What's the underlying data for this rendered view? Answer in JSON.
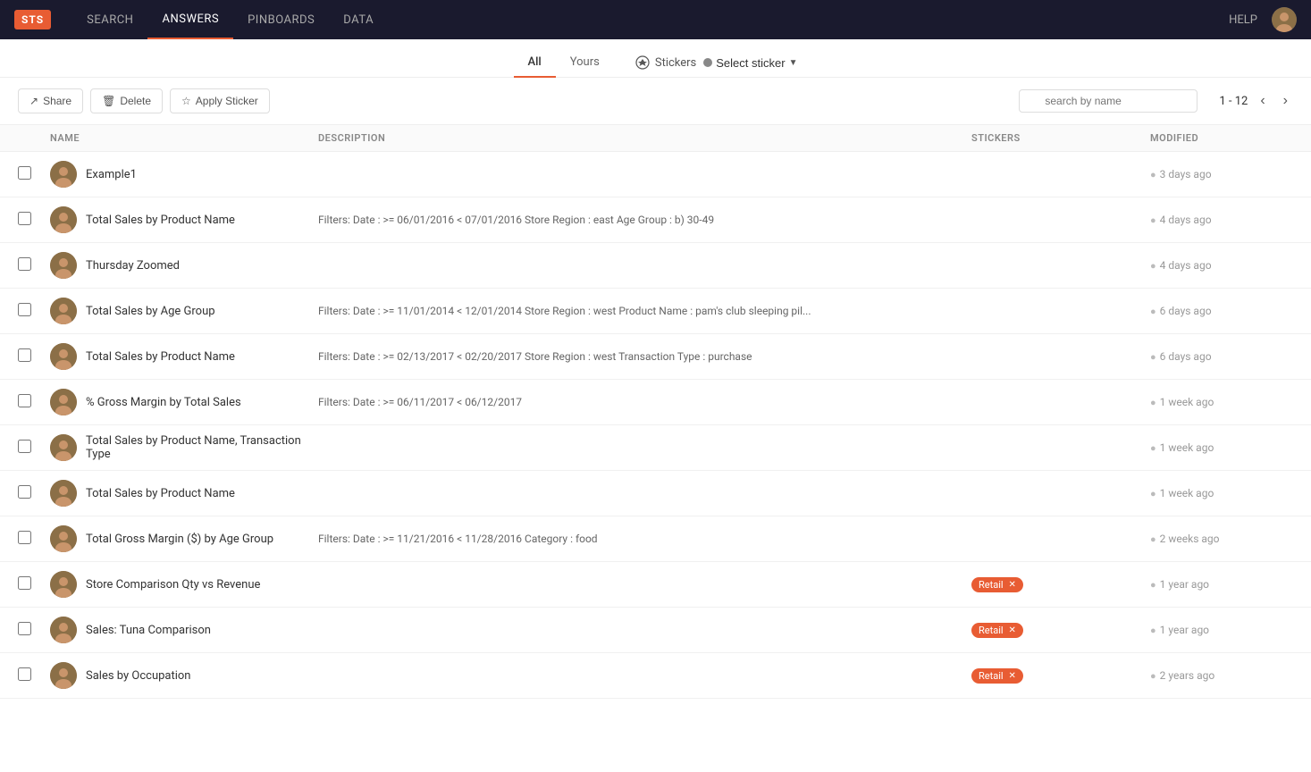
{
  "nav": {
    "logo": "STS",
    "items": [
      {
        "id": "search",
        "label": "SEARCH",
        "active": false
      },
      {
        "id": "answers",
        "label": "ANSWERS",
        "active": true
      },
      {
        "id": "pinboards",
        "label": "PINBOARDS",
        "active": false
      },
      {
        "id": "data",
        "label": "DATA",
        "active": false
      }
    ],
    "help": "HELP"
  },
  "filter_tabs": [
    {
      "id": "all",
      "label": "All",
      "active": true
    },
    {
      "id": "yours",
      "label": "Yours",
      "active": false
    }
  ],
  "stickers": {
    "label": "Stickers",
    "select_label": "Select sticker"
  },
  "toolbar": {
    "share_label": "Share",
    "delete_label": "Delete",
    "apply_sticker_label": "Apply Sticker",
    "search_placeholder": "search by name"
  },
  "pagination": {
    "range": "1 - 12"
  },
  "table": {
    "headers": [
      "",
      "NAME",
      "DESCRIPTION",
      "STICKERS",
      "MODIFIED"
    ],
    "rows": [
      {
        "id": 1,
        "name": "Example1",
        "description": "",
        "stickers": [],
        "modified": "3 days ago"
      },
      {
        "id": 2,
        "name": "Total Sales by Product Name",
        "description": "Filters: Date : >= 06/01/2016 < 07/01/2016 Store Region : east Age Group : b) 30-49",
        "stickers": [],
        "modified": "4 days ago"
      },
      {
        "id": 3,
        "name": "Thursday Zoomed",
        "description": "",
        "stickers": [],
        "modified": "4 days ago"
      },
      {
        "id": 4,
        "name": "Total Sales by Age Group",
        "description": "Filters: Date : >= 11/01/2014 < 12/01/2014 Store Region : west Product Name : pam's club sleeping pil...",
        "stickers": [],
        "modified": "6 days ago"
      },
      {
        "id": 5,
        "name": "Total Sales by Product Name",
        "description": "Filters: Date : >= 02/13/2017 < 02/20/2017 Store Region : west Transaction Type : purchase",
        "stickers": [],
        "modified": "6 days ago"
      },
      {
        "id": 6,
        "name": "% Gross Margin by Total Sales",
        "description": "Filters: Date : >= 06/11/2017 < 06/12/2017",
        "stickers": [],
        "modified": "1 week ago"
      },
      {
        "id": 7,
        "name": "Total Sales by Product Name, Transaction Type",
        "description": "",
        "stickers": [],
        "modified": "1 week ago"
      },
      {
        "id": 8,
        "name": "Total Sales by Product Name",
        "description": "",
        "stickers": [],
        "modified": "1 week ago"
      },
      {
        "id": 9,
        "name": "Total Gross Margin ($) by Age Group",
        "description": "Filters: Date : >= 11/21/2016 < 11/28/2016 Category : food",
        "stickers": [],
        "modified": "2 weeks ago"
      },
      {
        "id": 10,
        "name": "Store Comparison Qty vs Revenue",
        "description": "",
        "stickers": [
          "Retail"
        ],
        "modified": "1 year ago"
      },
      {
        "id": 11,
        "name": "Sales: Tuna Comparison",
        "description": "",
        "stickers": [
          "Retail"
        ],
        "modified": "1 year ago"
      },
      {
        "id": 12,
        "name": "Sales by Occupation",
        "description": "",
        "stickers": [
          "Retail"
        ],
        "modified": "2 years ago"
      }
    ]
  }
}
